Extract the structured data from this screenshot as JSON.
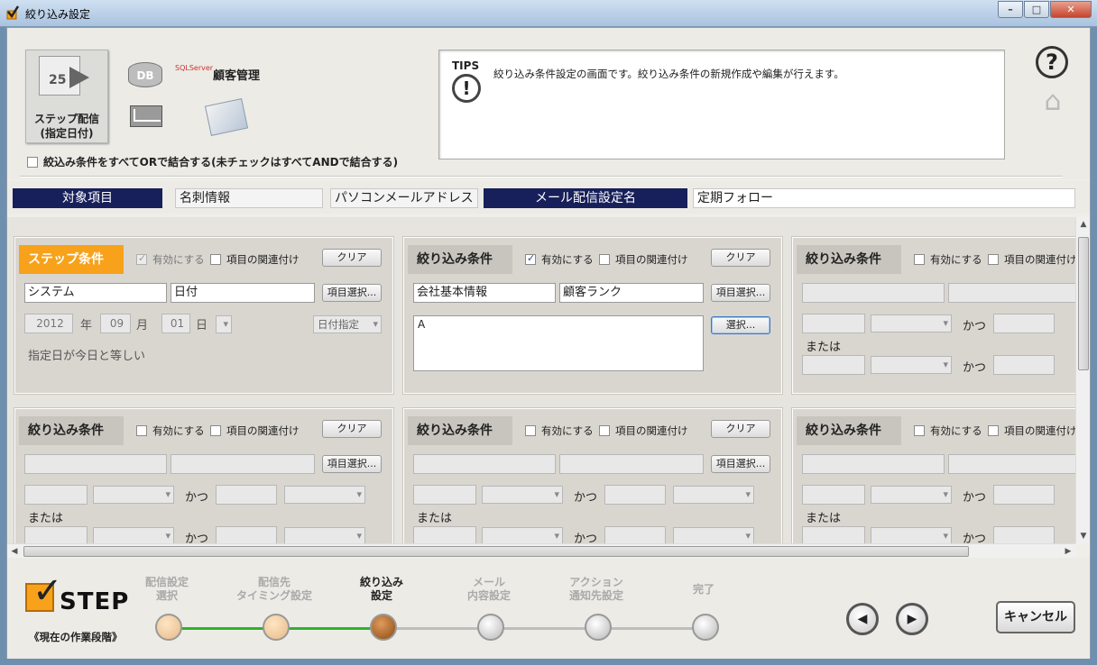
{
  "window": {
    "title": "絞り込み設定"
  },
  "toolbar": {
    "step_tile_number": "25",
    "step_tile_label_1": "ステップ配信",
    "step_tile_label_2": "(指定日付)",
    "db_icon_text": "DB",
    "sql_icon_text": "SQLServer",
    "customer_label": "顧客管理",
    "or_checkbox_label": "絞込み条件をすべてORで結合する(未チェックはすべてANDで結合する)"
  },
  "tips": {
    "label": "TIPS",
    "message": "絞り込み条件設定の画面です。絞り込み条件の新規作成や編集が行えます。"
  },
  "info": {
    "target_header": "対象項目",
    "target_value_1": "名刺情報",
    "target_value_2": "パソコンメールアドレス",
    "mail_header": "メール配信設定名",
    "mail_value": "定期フォロー"
  },
  "panels": {
    "step": {
      "title": "ステップ条件",
      "enable_label": "有効にする",
      "link_label": "項目の関連付け",
      "clear_label": "クリア",
      "field_1": "システム",
      "field_2": "日付",
      "item_select_label": "項目選択...",
      "year": "2012",
      "year_unit": "年",
      "month": "09",
      "month_unit": "月",
      "day": "01",
      "day_unit": "日",
      "date_mode": "日付指定",
      "description": "指定日が今日と等しい"
    },
    "filter_label": "絞り込み条件",
    "enable_label": "有効にする",
    "link_label": "項目の関連付け",
    "clear_label": "クリア",
    "item_select_label": "項目選択...",
    "select_label": "選択...",
    "and_label": "かつ",
    "or_label": "または",
    "p2_field_1": "会社基本情報",
    "p2_field_2": "顧客ランク",
    "p2_value": "A"
  },
  "footer": {
    "logo_word": "STEP",
    "phase_label": "《現在の作業段階》",
    "steps": [
      {
        "line1": "配信設定",
        "line2": "選択",
        "state": "done"
      },
      {
        "line1": "配信先",
        "line2": "タイミング設定",
        "state": "done"
      },
      {
        "line1": "絞り込み",
        "line2": "設定",
        "state": "current"
      },
      {
        "line1": "メール",
        "line2": "内容設定",
        "state": "todo"
      },
      {
        "line1": "アクション",
        "line2": "通知先設定",
        "state": "todo"
      },
      {
        "line1": "完了",
        "line2": "",
        "state": "todo"
      }
    ],
    "cancel_label": "キャンセル"
  }
}
